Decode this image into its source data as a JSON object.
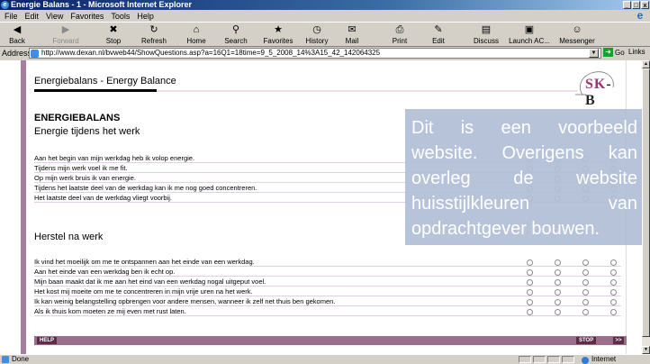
{
  "window": {
    "title": "Energie Balans - 1 - Microsoft Internet Explorer",
    "controls": [
      "_",
      "□",
      "x"
    ]
  },
  "menu": [
    "File",
    "Edit",
    "View",
    "Favorites",
    "Tools",
    "Help"
  ],
  "toolbar": [
    {
      "label": "Back",
      "icon": "◀",
      "disabled": false
    },
    {
      "label": "Forward",
      "icon": "▶",
      "disabled": true
    },
    {
      "label": "Stop",
      "icon": "✖",
      "disabled": false
    },
    {
      "label": "Refresh",
      "icon": "↻",
      "disabled": false
    },
    {
      "label": "Home",
      "icon": "⌂",
      "disabled": false
    },
    {
      "label": "Search",
      "icon": "⚲",
      "disabled": false
    },
    {
      "label": "Favorites",
      "icon": "★",
      "disabled": false
    },
    {
      "label": "History",
      "icon": "◷",
      "disabled": false
    },
    {
      "label": "Mail",
      "icon": "✉",
      "disabled": false
    },
    {
      "label": "Print",
      "icon": "⎙",
      "disabled": false
    },
    {
      "label": "Edit",
      "icon": "✎",
      "disabled": false
    },
    {
      "label": "Discuss",
      "icon": "▤",
      "disabled": false
    },
    {
      "label": "Launch AC...",
      "icon": "▣",
      "disabled": false
    },
    {
      "label": "Messenger",
      "icon": "☺",
      "disabled": false
    }
  ],
  "address": {
    "label": "Address",
    "url": "http://www.dexan.nl/bvweb44/ShowQuestions.asp?a=16Q1=18time=9_5_2008_14%3A15_42_142064325",
    "go_label": "Go",
    "links_label": "Links"
  },
  "page": {
    "header_title": "Energiebalans - Energy Balance",
    "logo_text_sk": "SK",
    "logo_text_b": "-B",
    "section_title": "ENERGIEBALANS",
    "section1_subtitle": "Energie tijdens het werk",
    "section1_questions": [
      "Aan het begin van mijn werkdag heb ik volop energie.",
      "Tijdens mijn werk voel ik me fit.",
      "Op mijn werk bruis ik van energie.",
      "Tijdens het laatste deel van de werkdag kan ik me nog goed concentreren.",
      "Het laatste deel van de werkdag vliegt voorbij."
    ],
    "section2_subtitle": "Herstel na werk",
    "section2_questions": [
      "Ik vind het moeilijk om me te ontspannen aan het einde van een werkdag.",
      "Aan het einde van een werkdag ben ik echt op.",
      "Mijn baan maakt dat ik me aan het eind van een werkdag nogal uitgeput voel.",
      "Het kost mij moeite om me te concentreren in mijn vrije uren na het werk.",
      "Ik kan weinig belangstelling opbrengen voor andere mensen, wanneer ik zelf net thuis ben gekomen.",
      "Als ik thuis kom moeten ze mij even met rust laten."
    ],
    "help_label": "HELP",
    "stop_label": "STOP",
    "next_label": ">>",
    "overlay_text": "Dit is een voorbeeld website. Overigens kan overleg de website huisstijlkleuren van opdrachtgever bouwen."
  },
  "status": {
    "text": "Done",
    "zone": "Internet"
  },
  "colors": {
    "accent": "#a77ea0",
    "footer_bar": "#9c6e8c",
    "button_dark": "#5a2d48",
    "overlay": "#b2bed6"
  }
}
